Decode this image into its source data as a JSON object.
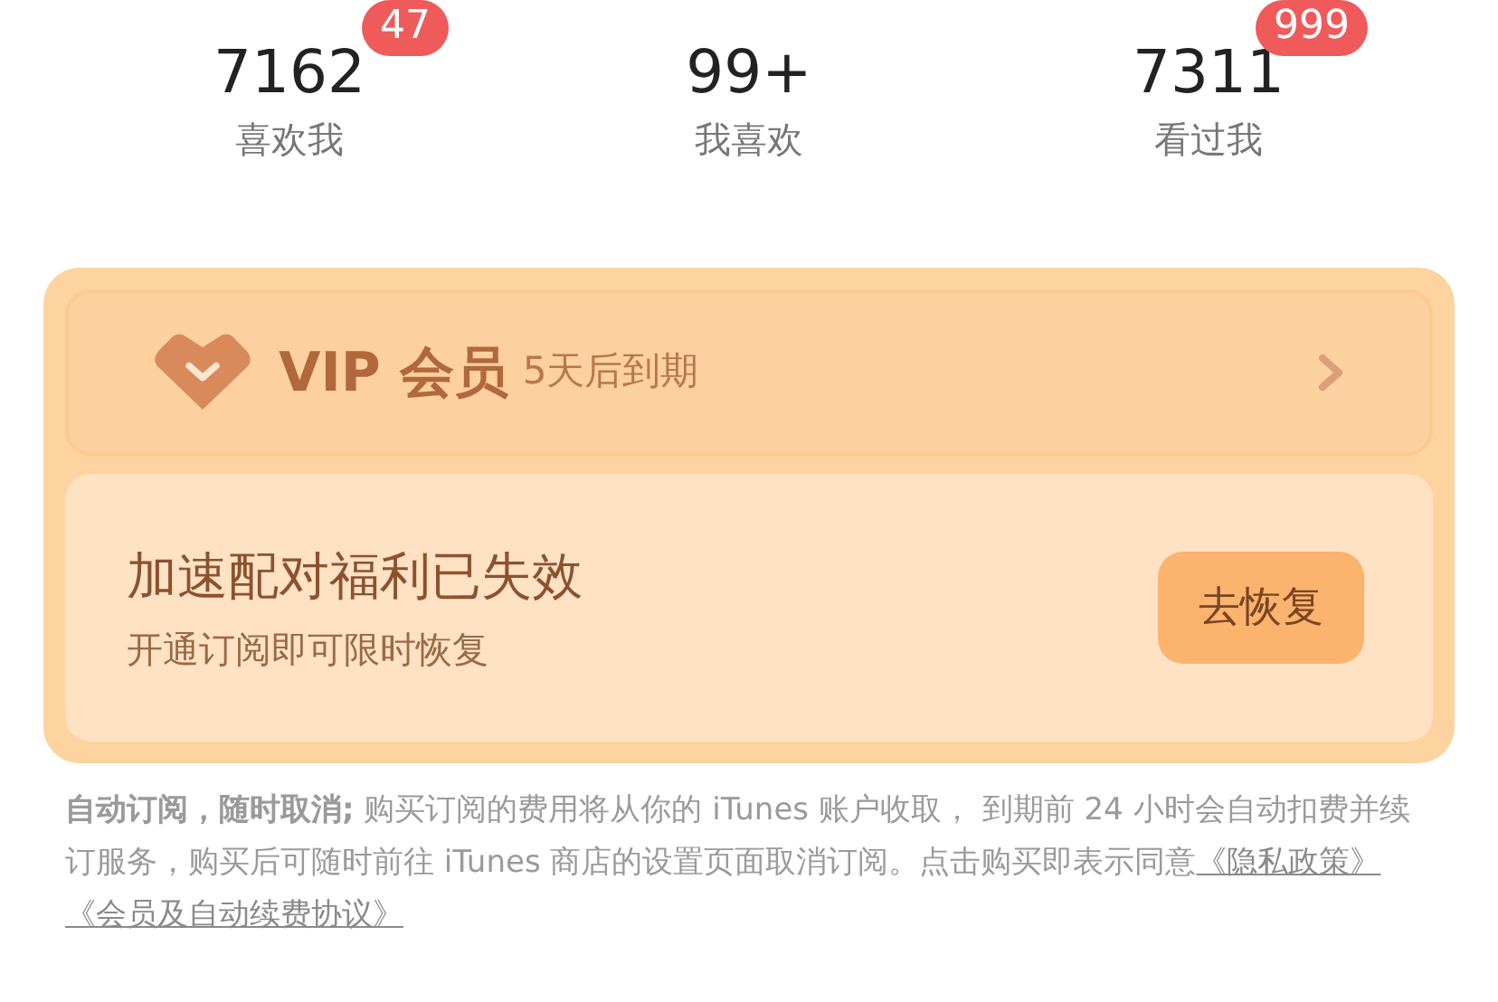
{
  "stats": [
    {
      "value": "7162",
      "label": "喜欢我",
      "badge": "47"
    },
    {
      "value": "99+",
      "label": "我喜欢"
    },
    {
      "value": "7311",
      "label": "看过我",
      "badge": "999"
    }
  ],
  "vip": {
    "title": "VIP 会员",
    "expiry": "5天后到期"
  },
  "boost": {
    "title": "加速配对福利已失效",
    "subtitle": "开通订阅即可限时恢复",
    "button": "去恢复"
  },
  "terms": {
    "lead": "自动订阅，随时取消;",
    "text": " 购买订阅的费用将从你的 iTunes 账户收取， 到期前 24 小时会自动扣费并续订服务，购买后可随时前往 iTunes 商店的设置页面取消订阅。点击购买即表示同意",
    "links": [
      "《隐私政策》",
      "《会员及自动续费协议》"
    ]
  }
}
